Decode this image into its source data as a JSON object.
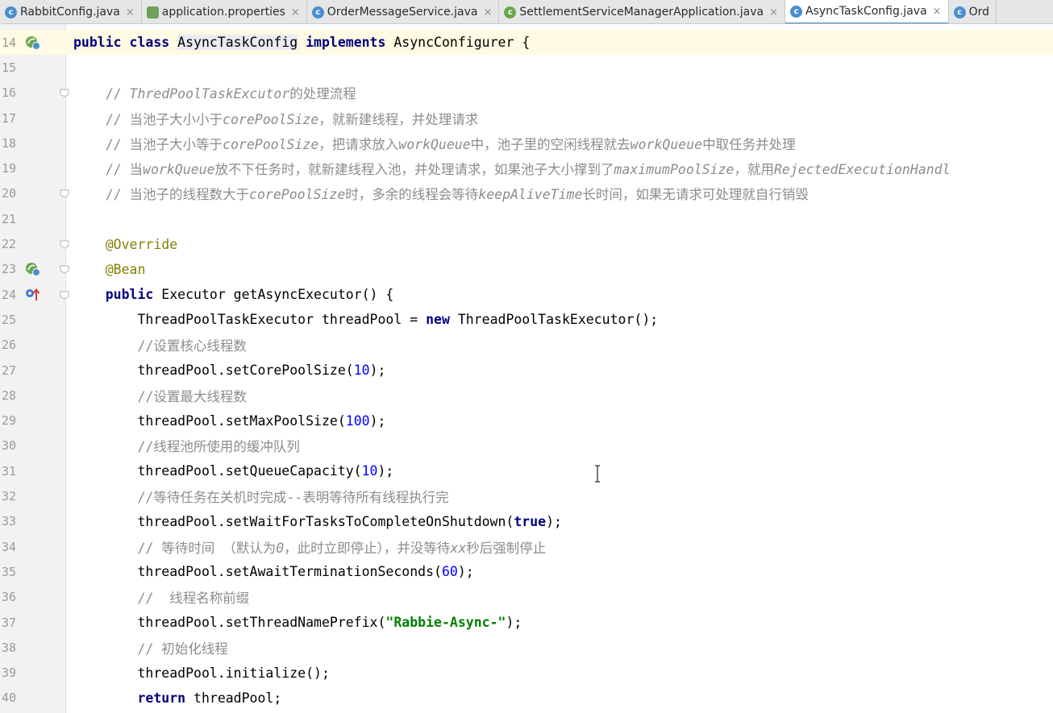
{
  "tabs": [
    {
      "label": "RabbitConfig.java",
      "icon": "java-class-icon",
      "active": false
    },
    {
      "label": "application.properties",
      "icon": "properties-file-icon",
      "active": false
    },
    {
      "label": "OrderMessageService.java",
      "icon": "java-class-icon",
      "active": false
    },
    {
      "label": "SettlementServiceManagerApplication.java",
      "icon": "spring-boot-class-icon",
      "active": false
    },
    {
      "label": "AsyncTaskConfig.java",
      "icon": "java-class-icon",
      "active": true
    },
    {
      "label": "Ord",
      "icon": "java-class-icon",
      "active": false
    }
  ],
  "close_glyph": "×",
  "colors": {
    "keyword": "#000080",
    "comment": "#8c8c8c",
    "annotation": "#808000",
    "number": "#0000ff",
    "string": "#008000",
    "current_line": "#fffae3"
  },
  "lines": [
    {
      "n": "14",
      "segs": [
        [
          "kw",
          "public class "
        ],
        [
          "cls-hl",
          "AsyncTaskConfig"
        ],
        [
          "",
          ""
        ],
        [
          "kw",
          " implements"
        ],
        [
          "",
          " AsyncConfigurer {"
        ]
      ]
    },
    {
      "n": "15",
      "segs": []
    },
    {
      "n": "16",
      "segs": [
        [
          "cm",
          "    // "
        ],
        [
          "cmi",
          "ThredPoolTaskExcutor"
        ],
        [
          "cm",
          "的处理流程"
        ]
      ]
    },
    {
      "n": "17",
      "segs": [
        [
          "cm",
          "    // 当池子大小小于"
        ],
        [
          "cmi",
          "corePoolSize"
        ],
        [
          "cm",
          "，就新建线程，并处理请求"
        ]
      ]
    },
    {
      "n": "18",
      "segs": [
        [
          "cm",
          "    // 当池子大小等于"
        ],
        [
          "cmi",
          "corePoolSize"
        ],
        [
          "cm",
          "，把请求放入"
        ],
        [
          "cmi",
          "workQueue"
        ],
        [
          "cm",
          "中，池子里的空闲线程就去"
        ],
        [
          "cmi",
          "workQueue"
        ],
        [
          "cm",
          "中取任务并处理"
        ]
      ]
    },
    {
      "n": "19",
      "segs": [
        [
          "cm",
          "    // 当"
        ],
        [
          "cmi",
          "workQueue"
        ],
        [
          "cm",
          "放不下任务时，就新建线程入池，并处理请求，如果池子大小撑到了"
        ],
        [
          "cmi",
          "maximumPoolSize"
        ],
        [
          "cm",
          "，就用"
        ],
        [
          "cmi",
          "RejectedExecutionHandl"
        ]
      ]
    },
    {
      "n": "20",
      "segs": [
        [
          "cm",
          "    // 当池子的线程数大于"
        ],
        [
          "cmi",
          "corePoolSize"
        ],
        [
          "cm",
          "时，多余的线程会等待"
        ],
        [
          "cmi",
          "keepAliveTime"
        ],
        [
          "cm",
          "长时间，如果无请求可处理就自行销毁"
        ]
      ]
    },
    {
      "n": "21",
      "segs": []
    },
    {
      "n": "22",
      "segs": [
        [
          "ann",
          "    @Override"
        ]
      ]
    },
    {
      "n": "23",
      "segs": [
        [
          "ann",
          "    @Bean"
        ]
      ]
    },
    {
      "n": "24",
      "segs": [
        [
          "kw",
          "    public"
        ],
        [
          "",
          " Executor getAsyncExecutor() {"
        ]
      ]
    },
    {
      "n": "25",
      "segs": [
        [
          "",
          "        ThreadPoolTaskExecutor threadPool = "
        ],
        [
          "kw",
          "new"
        ],
        [
          "",
          " ThreadPoolTaskExecutor();"
        ]
      ]
    },
    {
      "n": "26",
      "segs": [
        [
          "cm",
          "        //设置核心线程数"
        ]
      ]
    },
    {
      "n": "27",
      "segs": [
        [
          "",
          "        threadPool.setCorePoolSize("
        ],
        [
          "num",
          "10"
        ],
        [
          "",
          ");"
        ]
      ]
    },
    {
      "n": "28",
      "segs": [
        [
          "cm",
          "        //设置最大线程数"
        ]
      ]
    },
    {
      "n": "29",
      "segs": [
        [
          "",
          "        threadPool.setMaxPoolSize("
        ],
        [
          "num",
          "100"
        ],
        [
          "",
          ");"
        ]
      ]
    },
    {
      "n": "30",
      "segs": [
        [
          "cm",
          "        //线程池所使用的缓冲队列"
        ]
      ]
    },
    {
      "n": "31",
      "segs": [
        [
          "",
          "        threadPool.setQueueCapacity("
        ],
        [
          "num",
          "10"
        ],
        [
          "",
          ");"
        ]
      ]
    },
    {
      "n": "32",
      "segs": [
        [
          "cm",
          "        //等待任务在关机时完成--表明等待所有线程执行完"
        ]
      ]
    },
    {
      "n": "33",
      "segs": [
        [
          "",
          "        threadPool.setWaitForTasksToCompleteOnShutdown("
        ],
        [
          "kw",
          "true"
        ],
        [
          "",
          ");"
        ]
      ]
    },
    {
      "n": "34",
      "segs": [
        [
          "cm",
          "        // 等待时间 （默认为"
        ],
        [
          "cmi",
          "0"
        ],
        [
          "cm",
          "，此时立即停止），并没等待"
        ],
        [
          "cmi",
          "xx"
        ],
        [
          "cm",
          "秒后强制停止"
        ]
      ]
    },
    {
      "n": "35",
      "segs": [
        [
          "",
          "        threadPool.setAwaitTerminationSeconds("
        ],
        [
          "num",
          "60"
        ],
        [
          "",
          ");"
        ]
      ]
    },
    {
      "n": "36",
      "segs": [
        [
          "cm",
          "        //  线程名称前缀"
        ]
      ]
    },
    {
      "n": "37",
      "segs": [
        [
          "",
          "        threadPool.setThreadNamePrefix("
        ],
        [
          "str",
          "\"Rabbie-Async-\""
        ],
        [
          "",
          ");"
        ]
      ]
    },
    {
      "n": "38",
      "segs": [
        [
          "cm",
          "        // 初始化线程"
        ]
      ]
    },
    {
      "n": "39",
      "segs": [
        [
          "",
          "        threadPool.initialize();"
        ]
      ]
    },
    {
      "n": "40",
      "segs": [
        [
          "kw",
          "        return"
        ],
        [
          "",
          " threadPool;"
        ]
      ]
    }
  ],
  "gutter_marks": {
    "14": "spring-bean-icon",
    "23": "spring-bean-navigate-icon",
    "24": "override-implement-icon"
  },
  "fold_marks": [
    "16",
    "20",
    "22",
    "23",
    "24"
  ]
}
